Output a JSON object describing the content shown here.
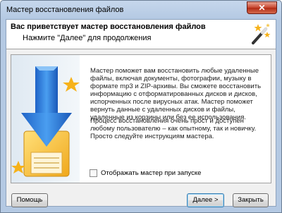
{
  "window": {
    "title": "Мастер восстановления файлов",
    "close_glyph": "✕"
  },
  "header": {
    "title": "Вас приветствует мастер восстановления файлов",
    "subtitle": "Нажмите \"Далее\" для продолжения",
    "icon": "magic-wand-icon"
  },
  "body": {
    "paragraph1": "Мастер поможет вам восстановить любые удаленные файлы, включая документы, фотографии, музыку в формате mp3 и ZIP-архивы. Вы сможете восстановить информацию с отформатированных дисков и дисков, испорченных после вирусных атак. Мастер поможет вернуть данные с удаленных дисков и файлы, удаленные из корзины или без ее использования.",
    "paragraph2": "Процесс восстановления очень прост и доступен любому пользователю – как опытному, так и новичку. Просто следуйте инструкциям мастера.",
    "illustration": "download-arrow-floppy-icon"
  },
  "checkbox": {
    "label": "Отображать мастер при запуске",
    "checked": false
  },
  "buttons": {
    "help": "Помощь",
    "next": "Далее >",
    "close": "Закрыть"
  }
}
